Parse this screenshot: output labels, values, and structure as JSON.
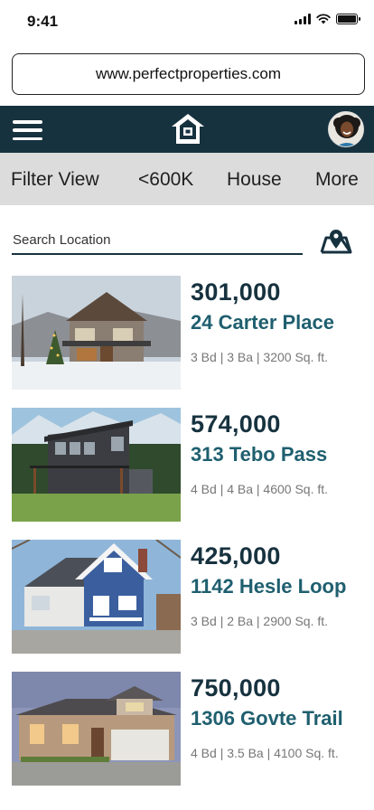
{
  "status": {
    "time": "9:41"
  },
  "browser": {
    "url": "www.perfectproperties.com"
  },
  "filters": {
    "items": [
      {
        "label": "Filter View"
      },
      {
        "label": "<600K"
      },
      {
        "label": "House"
      },
      {
        "label": "More"
      }
    ]
  },
  "search": {
    "placeholder": "Search Location"
  },
  "listings": [
    {
      "price": "301,000",
      "address": "24 Carter Place",
      "details": "3 Bd | 3 Ba | 3200 Sq. ft."
    },
    {
      "price": "574,000",
      "address": "313 Tebo Pass",
      "details": "4 Bd | 4 Ba | 4600 Sq. ft."
    },
    {
      "price": "425,000",
      "address": "1142 Hesle Loop",
      "details": "3 Bd | 2 Ba | 2900 Sq. ft."
    },
    {
      "price": "750,000",
      "address": "1306 Govte Trail",
      "details": "4 Bd | 3.5 Ba | 4100 Sq. ft."
    }
  ],
  "colors": {
    "navy": "#17323f",
    "teal": "#1f5f6f",
    "filter_bg": "#dcdcdc"
  },
  "icons": [
    "signal-icon",
    "wifi-icon",
    "battery-icon",
    "menu-icon",
    "home-logo-icon",
    "map-icon"
  ]
}
